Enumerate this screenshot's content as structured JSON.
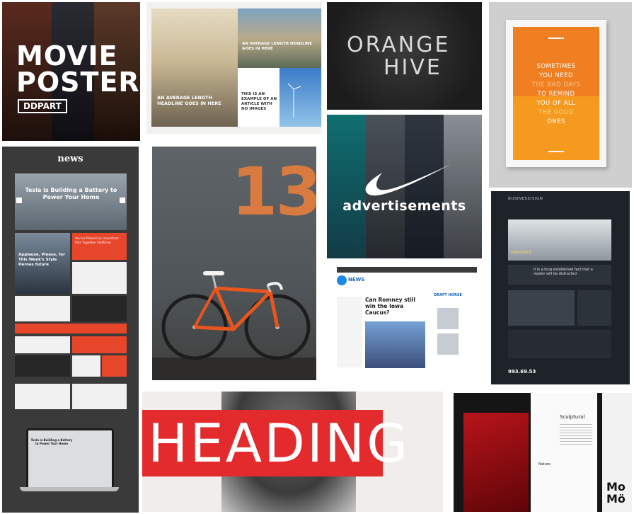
{
  "tiles": {
    "movie": {
      "title_line1": "MOVIE",
      "title_line2": "POSTERS",
      "badge": "DDPART"
    },
    "magazine": {
      "hero_headline": "AN AVERAGE LENGTH HEADLINE GOES IN HERE",
      "canal_headline": "AN AVERAGE LENGTH HEADLINE GOES IN HERE",
      "card_headline": "THIS IS AN EXAMPLE OF AN ARTICLE WITH NO IMAGES"
    },
    "hive": {
      "line1": "ORANGE",
      "line2": "HIVE"
    },
    "poster": {
      "lines": [
        "SOMETIMES",
        "YOU NEED",
        "THE BAD DAYS",
        "TO REMIND",
        "YOU OF ALL",
        "THE GOOD",
        "ONES"
      ]
    },
    "news": {
      "header": "news",
      "hero_title": "Tesla is Building a Battery to Power Your Home",
      "card_a": "Applause, Please, for This Week's Style Heroes future",
      "card_b": "You've Placed an Important Part Together Halftime",
      "laptop_title": "Tesla is Building a Battery to Power Your Home"
    },
    "bike": {
      "number": "13"
    },
    "ads": {
      "label": "advertisements"
    },
    "business": {
      "logo": "BUSINESS/SIGN",
      "hero_caption": "ANNOUNCE",
      "bar_text": "It is a long established fact that a reader will be distracted",
      "phone": "993.69.53"
    },
    "site": {
      "logo": "NEWS",
      "headline": "Can Romney still win the Iowa Caucus?",
      "side_label": "DRAFT HORSE"
    },
    "heading": {
      "word": "HEADING"
    },
    "sculpt": {
      "title": "Sculptural",
      "section": "Nature",
      "mo_line1": "Mo",
      "mo_line2": "Mö"
    }
  },
  "colors": {
    "orange": "#f07f22",
    "red": "#e32a2c",
    "news_red": "#e8462a",
    "blue": "#1565c0"
  }
}
